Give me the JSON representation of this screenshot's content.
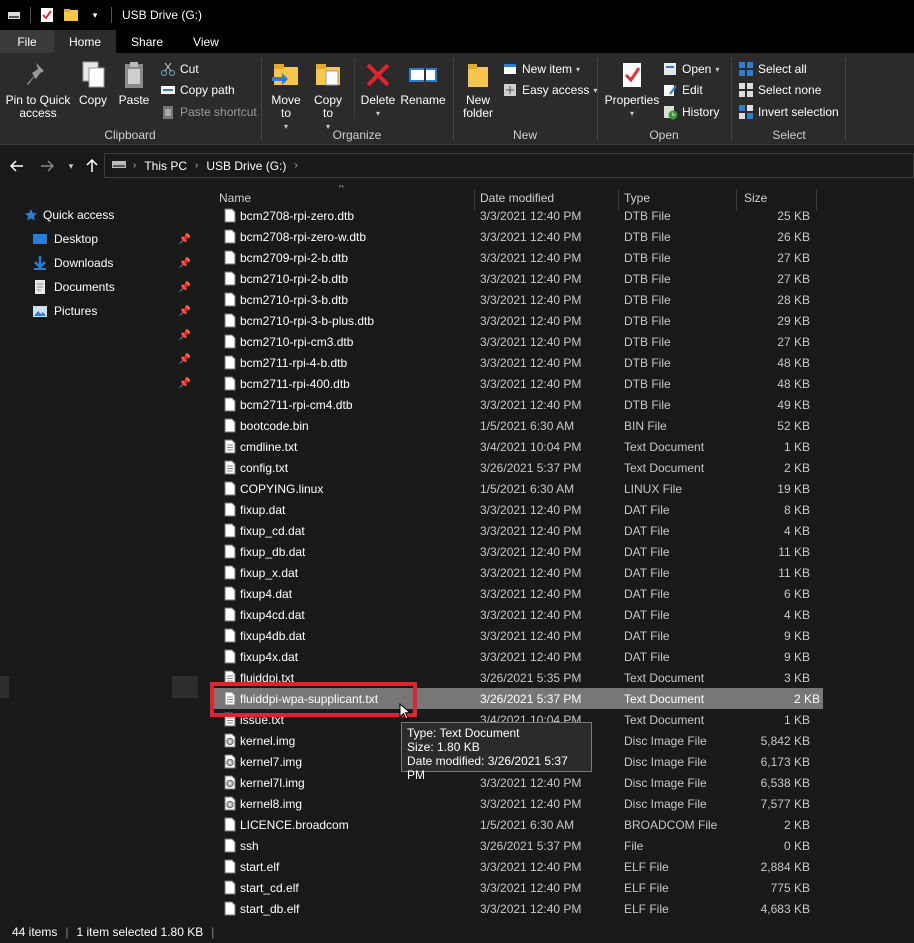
{
  "titlebar": {
    "title": "USB Drive (G:)"
  },
  "tabs": {
    "file": "File",
    "home": "Home",
    "share": "Share",
    "view": "View"
  },
  "ribbon": {
    "clipboard": {
      "label": "Clipboard",
      "pin": "Pin to Quick access",
      "copy": "Copy",
      "paste": "Paste",
      "cut": "Cut",
      "copy_path": "Copy path",
      "paste_shortcut": "Paste shortcut"
    },
    "organize": {
      "label": "Organize",
      "move_to": "Move to",
      "copy_to": "Copy to",
      "delete": "Delete",
      "rename": "Rename"
    },
    "new": {
      "label": "New",
      "new_folder": "New folder",
      "new_item": "New item",
      "easy_access": "Easy access"
    },
    "open": {
      "label": "Open",
      "properties": "Properties",
      "open": "Open",
      "edit": "Edit",
      "history": "History"
    },
    "select": {
      "label": "Select",
      "select_all": "Select all",
      "select_none": "Select none",
      "invert": "Invert selection"
    }
  },
  "address": {
    "crumbs": [
      "This PC",
      "USB Drive (G:)"
    ]
  },
  "navpane": {
    "quick_access": "Quick access",
    "items": [
      "Desktop",
      "Downloads",
      "Documents",
      "Pictures"
    ]
  },
  "columns": {
    "name": "Name",
    "date": "Date modified",
    "type": "Type",
    "size": "Size"
  },
  "files": [
    {
      "name": "bcm2708-rpi-zero.dtb",
      "date": "3/3/2021 12:40 PM",
      "type": "DTB File",
      "size": "25 KB",
      "icon": "file"
    },
    {
      "name": "bcm2708-rpi-zero-w.dtb",
      "date": "3/3/2021 12:40 PM",
      "type": "DTB File",
      "size": "26 KB",
      "icon": "file"
    },
    {
      "name": "bcm2709-rpi-2-b.dtb",
      "date": "3/3/2021 12:40 PM",
      "type": "DTB File",
      "size": "27 KB",
      "icon": "file"
    },
    {
      "name": "bcm2710-rpi-2-b.dtb",
      "date": "3/3/2021 12:40 PM",
      "type": "DTB File",
      "size": "27 KB",
      "icon": "file"
    },
    {
      "name": "bcm2710-rpi-3-b.dtb",
      "date": "3/3/2021 12:40 PM",
      "type": "DTB File",
      "size": "28 KB",
      "icon": "file"
    },
    {
      "name": "bcm2710-rpi-3-b-plus.dtb",
      "date": "3/3/2021 12:40 PM",
      "type": "DTB File",
      "size": "29 KB",
      "icon": "file"
    },
    {
      "name": "bcm2710-rpi-cm3.dtb",
      "date": "3/3/2021 12:40 PM",
      "type": "DTB File",
      "size": "27 KB",
      "icon": "file"
    },
    {
      "name": "bcm2711-rpi-4-b.dtb",
      "date": "3/3/2021 12:40 PM",
      "type": "DTB File",
      "size": "48 KB",
      "icon": "file"
    },
    {
      "name": "bcm2711-rpi-400.dtb",
      "date": "3/3/2021 12:40 PM",
      "type": "DTB File",
      "size": "48 KB",
      "icon": "file"
    },
    {
      "name": "bcm2711-rpi-cm4.dtb",
      "date": "3/3/2021 12:40 PM",
      "type": "DTB File",
      "size": "49 KB",
      "icon": "file"
    },
    {
      "name": "bootcode.bin",
      "date": "1/5/2021 6:30 AM",
      "type": "BIN File",
      "size": "52 KB",
      "icon": "file"
    },
    {
      "name": "cmdline.txt",
      "date": "3/4/2021 10:04 PM",
      "type": "Text Document",
      "size": "1 KB",
      "icon": "text"
    },
    {
      "name": "config.txt",
      "date": "3/26/2021 5:37 PM",
      "type": "Text Document",
      "size": "2 KB",
      "icon": "text"
    },
    {
      "name": "COPYING.linux",
      "date": "1/5/2021 6:30 AM",
      "type": "LINUX File",
      "size": "19 KB",
      "icon": "file"
    },
    {
      "name": "fixup.dat",
      "date": "3/3/2021 12:40 PM",
      "type": "DAT File",
      "size": "8 KB",
      "icon": "file"
    },
    {
      "name": "fixup_cd.dat",
      "date": "3/3/2021 12:40 PM",
      "type": "DAT File",
      "size": "4 KB",
      "icon": "file"
    },
    {
      "name": "fixup_db.dat",
      "date": "3/3/2021 12:40 PM",
      "type": "DAT File",
      "size": "11 KB",
      "icon": "file"
    },
    {
      "name": "fixup_x.dat",
      "date": "3/3/2021 12:40 PM",
      "type": "DAT File",
      "size": "11 KB",
      "icon": "file"
    },
    {
      "name": "fixup4.dat",
      "date": "3/3/2021 12:40 PM",
      "type": "DAT File",
      "size": "6 KB",
      "icon": "file"
    },
    {
      "name": "fixup4cd.dat",
      "date": "3/3/2021 12:40 PM",
      "type": "DAT File",
      "size": "4 KB",
      "icon": "file"
    },
    {
      "name": "fixup4db.dat",
      "date": "3/3/2021 12:40 PM",
      "type": "DAT File",
      "size": "9 KB",
      "icon": "file"
    },
    {
      "name": "fixup4x.dat",
      "date": "3/3/2021 12:40 PM",
      "type": "DAT File",
      "size": "9 KB",
      "icon": "file"
    },
    {
      "name": "fluiddpi.txt",
      "date": "3/26/2021 5:35 PM",
      "type": "Text Document",
      "size": "3 KB",
      "icon": "text"
    },
    {
      "name": "fluiddpi-wpa-supplicant.txt",
      "date": "3/26/2021 5:37 PM",
      "type": "Text Document",
      "size": "2 KB",
      "icon": "text",
      "selected": true
    },
    {
      "name": "issue.txt",
      "date": "3/4/2021 10:04 PM",
      "type": "Text Document",
      "size": "1 KB",
      "icon": "text"
    },
    {
      "name": "kernel.img",
      "date": "3/3/2021 12:40 PM",
      "type": "Disc Image File",
      "size": "5,842 KB",
      "icon": "disc"
    },
    {
      "name": "kernel7.img",
      "date": "3/3/2021 12:40 PM",
      "type": "Disc Image File",
      "size": "6,173 KB",
      "icon": "disc"
    },
    {
      "name": "kernel7l.img",
      "date": "3/3/2021 12:40 PM",
      "type": "Disc Image File",
      "size": "6,538 KB",
      "icon": "disc"
    },
    {
      "name": "kernel8.img",
      "date": "3/3/2021 12:40 PM",
      "type": "Disc Image File",
      "size": "7,577 KB",
      "icon": "disc"
    },
    {
      "name": "LICENCE.broadcom",
      "date": "1/5/2021 6:30 AM",
      "type": "BROADCOM File",
      "size": "2 KB",
      "icon": "file"
    },
    {
      "name": "ssh",
      "date": "3/26/2021 5:37 PM",
      "type": "File",
      "size": "0 KB",
      "icon": "file"
    },
    {
      "name": "start.elf",
      "date": "3/3/2021 12:40 PM",
      "type": "ELF File",
      "size": "2,884 KB",
      "icon": "file"
    },
    {
      "name": "start_cd.elf",
      "date": "3/3/2021 12:40 PM",
      "type": "ELF File",
      "size": "775 KB",
      "icon": "file"
    },
    {
      "name": "start_db.elf",
      "date": "3/3/2021 12:40 PM",
      "type": "ELF File",
      "size": "4,683 KB",
      "icon": "file"
    }
  ],
  "tooltip": {
    "type": "Type: Text Document",
    "size": "Size: 1.80 KB",
    "date": "Date modified: 3/26/2021 5:37 PM"
  },
  "status": {
    "count": "44 items",
    "selection": "1 item selected  1.80 KB"
  },
  "colors": {
    "highlight": "#e0232c",
    "selection": "#777777",
    "accent": "#2a7fd4"
  }
}
